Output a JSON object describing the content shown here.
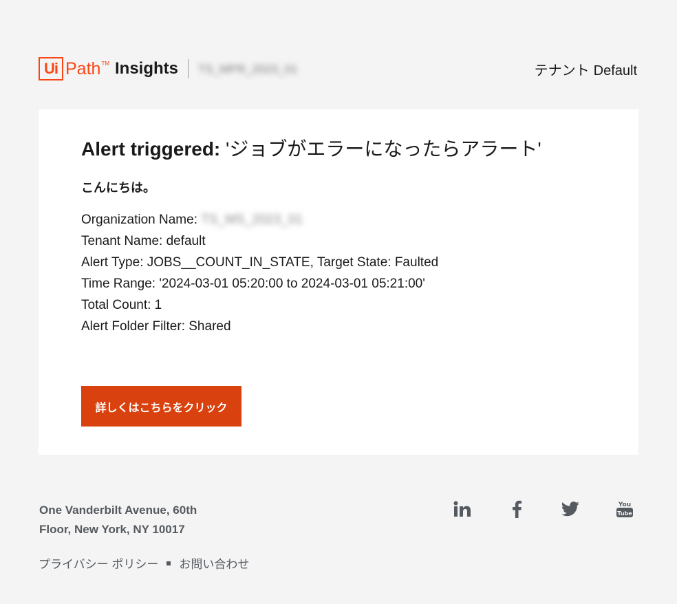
{
  "header": {
    "logo_ui": "Ui",
    "logo_path": "Path",
    "logo_tm": "TM",
    "logo_product": "Insights",
    "org_blurred": "TS_MPR_2023_01",
    "tenant_label": "テナント",
    "tenant_value": "Default"
  },
  "card": {
    "title_bold": "Alert triggered:",
    "title_rest": "'ジョブがエラーになったらアラート'",
    "greeting": "こんにちは。",
    "organization_label": "Organization Name:",
    "organization_value_blurred": "TS_MS_2023_01",
    "tenant_line": "Tenant Name: default",
    "alert_type_line": "Alert Type: JOBS__COUNT_IN_STATE, Target State: Faulted",
    "time_range_line": "Time Range: '2024-03-01 05:20:00 to 2024-03-01 05:21:00'",
    "total_count_line": "Total Count: 1",
    "folder_filter_line": "Alert Folder Filter: Shared",
    "cta_label": "詳しくはこちらをクリック",
    "accent_color": "#d9410f"
  },
  "footer": {
    "address_line1": "One Vanderbilt Avenue, 60th",
    "address_line2": "Floor, New York, NY 10017",
    "social_icons": [
      "linkedin-icon",
      "facebook-icon",
      "twitter-icon",
      "youtube-icon"
    ],
    "privacy_link": "プライバシー ポリシー",
    "contact_link": "お問い合わせ"
  },
  "colors": {
    "brand": "#fa4616",
    "footer_text": "#555a60",
    "background": "#f4f4f4"
  }
}
